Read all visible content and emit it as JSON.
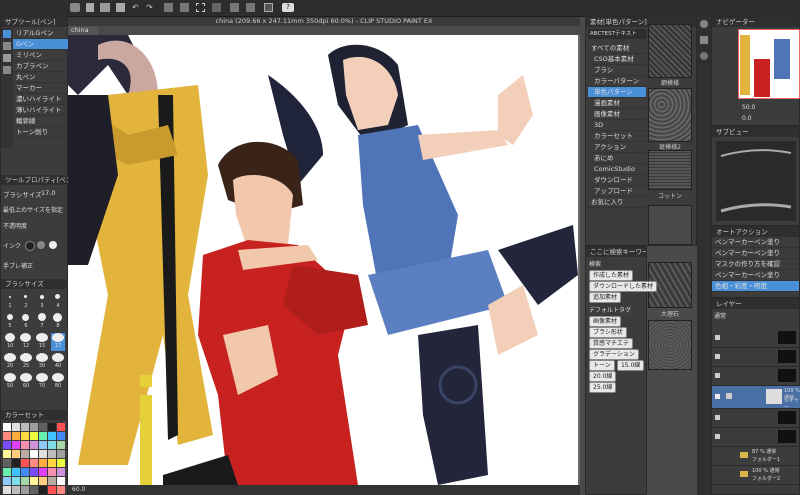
{
  "top_bar": {
    "canvas_tab": "china"
  },
  "title_bar": {
    "title": "china (209.66 x 247.11mm 350dpi 60.0%) - CLIP STUDIO PAINT EX"
  },
  "left_panel": {
    "subtool_header": "サブツール[ペン]",
    "brush_items": [
      "リアルGペン",
      "Gペン",
      "ミリペン",
      "カブラペン",
      "丸ペン",
      "マーカー",
      "濃いハイライト",
      "薄いハイライト",
      "輪郭線",
      "トーン削り"
    ],
    "tool_property_header": "ツールプロパティ[ペン]",
    "size_label": "ブラシサイズ",
    "size_value": "17.0",
    "min_size_label": "最低上のサイズを指定",
    "density_label": "不透明度",
    "ink_label": "インク",
    "stabilize_label": "手ブレ補正",
    "brush_size_header": "ブラシサイズ",
    "brush_sizes": [
      "1",
      "2",
      "3",
      "4",
      "5",
      "6",
      "7",
      "8",
      "10",
      "12",
      "15",
      "17",
      "20",
      "25",
      "30",
      "40",
      "50",
      "60",
      "70",
      "80",
      "100",
      "120",
      "150"
    ],
    "color_set_header": "カラーセット"
  },
  "material_panel": {
    "header": "素材[単色パターン]",
    "search_label": "ABCTESTテキスト",
    "tree": [
      "すべての素材",
      "CSO基本素材",
      "ブラシ",
      "カラーパターン",
      "単色パターン",
      "漫画素材",
      "画像素材",
      "3D",
      "カラーセット",
      "アクション",
      "あにめ",
      "ComicStudio",
      "ダウンロード",
      "アップロード",
      "お気に入り"
    ],
    "tiles": [
      "網模様",
      "斑模様2",
      "コットン",
      "大理石"
    ]
  },
  "search_panel": {
    "header": "ここに検索キーワード",
    "tags_label": "検索",
    "tags": [
      "作成した素材",
      "ダウンロードした素材",
      "追加素材"
    ],
    "default_tags_label": "デフォルトタグ",
    "default_tags": [
      "画像素材",
      "ブラシ形状",
      "質感マチエテ",
      "グラデーション",
      "トーン",
      "15.0線",
      "20.0線",
      "25.0線"
    ]
  },
  "navigator": {
    "header": "ナビゲーター",
    "zoom": "50.0",
    "angle": "0.0"
  },
  "subview": {
    "header": "サブビュー"
  },
  "auto_actions": {
    "header": "オートアクション",
    "items": [
      "ペンマーカーペン塗り",
      "ペンマーカーペン塗り",
      "マスクの作り方を確認",
      "ペンマーカーペン塗り",
      "ペンマーカーペン塗り",
      "色相・彩度・明度"
    ]
  },
  "layers": {
    "header": "レイヤー",
    "blend_mode": "通常",
    "opacity_label": "100",
    "items": [
      {
        "name": "",
        "sub": ""
      },
      {
        "name": "",
        "sub": ""
      },
      {
        "name": "",
        "sub": ""
      },
      {
        "name": "100 % 通常",
        "sub": "レイヤー"
      },
      {
        "name": "",
        "sub": ""
      },
      {
        "name": "",
        "sub": ""
      },
      {
        "name": "87 % 通常",
        "sub": "フォルダー1"
      },
      {
        "name": "100 % 通常",
        "sub": "フォルダー2"
      }
    ]
  },
  "status": {
    "zoom": "60.0"
  },
  "colors": {
    "accent": "#4a90d9",
    "canvas_bg": "#ffffff"
  }
}
